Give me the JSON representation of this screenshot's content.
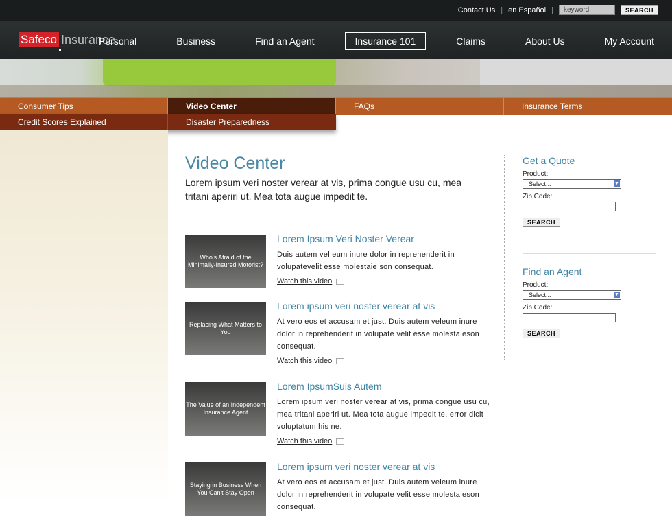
{
  "top": {
    "contact": "Contact Us",
    "spanish": "en Español",
    "keyword_placeholder": "keyword",
    "search": "SEARCH"
  },
  "logo": {
    "brand": "Safeco",
    "suffix": "Insurance"
  },
  "nav": {
    "items": [
      "Personal",
      "Business",
      "Find an Agent",
      "Insurance 101",
      "Claims",
      "About Us",
      "My Account"
    ],
    "active": "Insurance 101"
  },
  "subnav": {
    "items": [
      "Consumer Tips",
      "Video Center",
      "FAQs",
      "Insurance Terms"
    ],
    "active": "Video Center",
    "dropdown": [
      "Credit Scores Explained",
      "Disaster Preparedness"
    ]
  },
  "page": {
    "title": "Video Center",
    "intro": "Lorem ipsum veri noster verear at vis, prima congue usu cu, mea tritani aperiri ut. Mea tota augue impedit te."
  },
  "videos": [
    {
      "thumb": "Who's Afraid of the Minimally-Insured Motorist?",
      "title": "Lorem Ipsum Veri Noster Verear",
      "desc": "Duis autem vel eum inure dolor in reprehenderit in volupatevelit esse molestaie son consequat.",
      "watch": "Watch this video"
    },
    {
      "thumb": "Replacing What Matters to You",
      "title": "Lorem ipsum veri noster verear at vis",
      "desc": "At vero eos et accusam et just. Duis autem veleum inure dolor in reprehenderit in volupate velit esse molestaieson consequat.",
      "watch": "Watch this video"
    },
    {
      "thumb": "The Value of an Independent Insurance Agent",
      "title": "Lorem IpsumSuis Autem",
      "desc": "Lorem ipsum veri noster verear at vis, prima congue usu cu, mea tritani aperiri ut. Mea tota augue impedit te, error dicit voluptatum his ne.",
      "watch": "Watch this video"
    },
    {
      "thumb": "Staying in Business When You Can't Stay Open",
      "title": "Lorem ipsum veri noster verear at vis",
      "desc": "At vero eos et accusam et just. Duis autem veleum inure dolor in reprehenderit in volupate velit esse molestaieson consequat.",
      "watch": "Watch this video"
    }
  ],
  "sidebar": {
    "quote": {
      "title": "Get a Quote",
      "product_label": "Product:",
      "product_value": "Select...",
      "zip_label": "Zip Code:",
      "button": "SEARCH"
    },
    "agent": {
      "title": "Find an Agent",
      "product_label": "Product:",
      "product_value": "Select...",
      "zip_label": "Zip Code:",
      "button": "SEARCH"
    }
  },
  "colors": {
    "accent": "#b45a22",
    "active_sub": "#4a1c0a",
    "link_blue": "#3d84a4",
    "brand_red": "#d2232a"
  }
}
